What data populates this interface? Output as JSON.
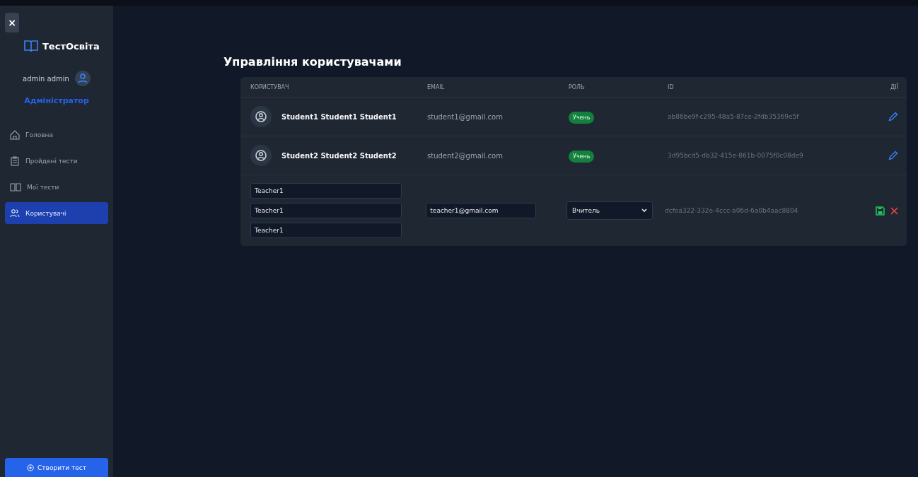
{
  "sidebar": {
    "close": "×",
    "brand": "ТестОсвіта",
    "user_name": "admin admin",
    "role": "Адміністратор",
    "items": [
      {
        "label": "Головна",
        "selected": false
      },
      {
        "label": "Пройдені тести",
        "selected": false
      },
      {
        "label": "Мої тести",
        "selected": false
      },
      {
        "label": "Користувачі",
        "selected": true
      }
    ],
    "create_button": "Створити тест"
  },
  "page_title": "Управління користувачами",
  "table": {
    "columns": [
      "КОРИСТУВАЧ",
      "EMAIL",
      "РОЛЬ",
      "ID",
      "ДІЇ"
    ],
    "rows": [
      {
        "kind": "display",
        "name": "Student1 Student1 Student1",
        "email": "student1@gmail.com",
        "role": "Учень",
        "id": "ab86be9f-c295-48a5-87ce-2fdb35369e5f"
      },
      {
        "kind": "display",
        "name": "Student2 Student2 Student2",
        "email": "student2@gmail.com",
        "role": "Учень",
        "id": "3d95bcd5-db32-415e-861b-0075f0c08de9"
      },
      {
        "kind": "edit",
        "name_fields": [
          "Teacher1",
          "Teacher1",
          "Teacher1"
        ],
        "email": "teacher1@gmail.com",
        "role": "Вчитель",
        "id": "dcfea322-332e-4ccc-a06d-6a0b4aac8804"
      }
    ]
  }
}
